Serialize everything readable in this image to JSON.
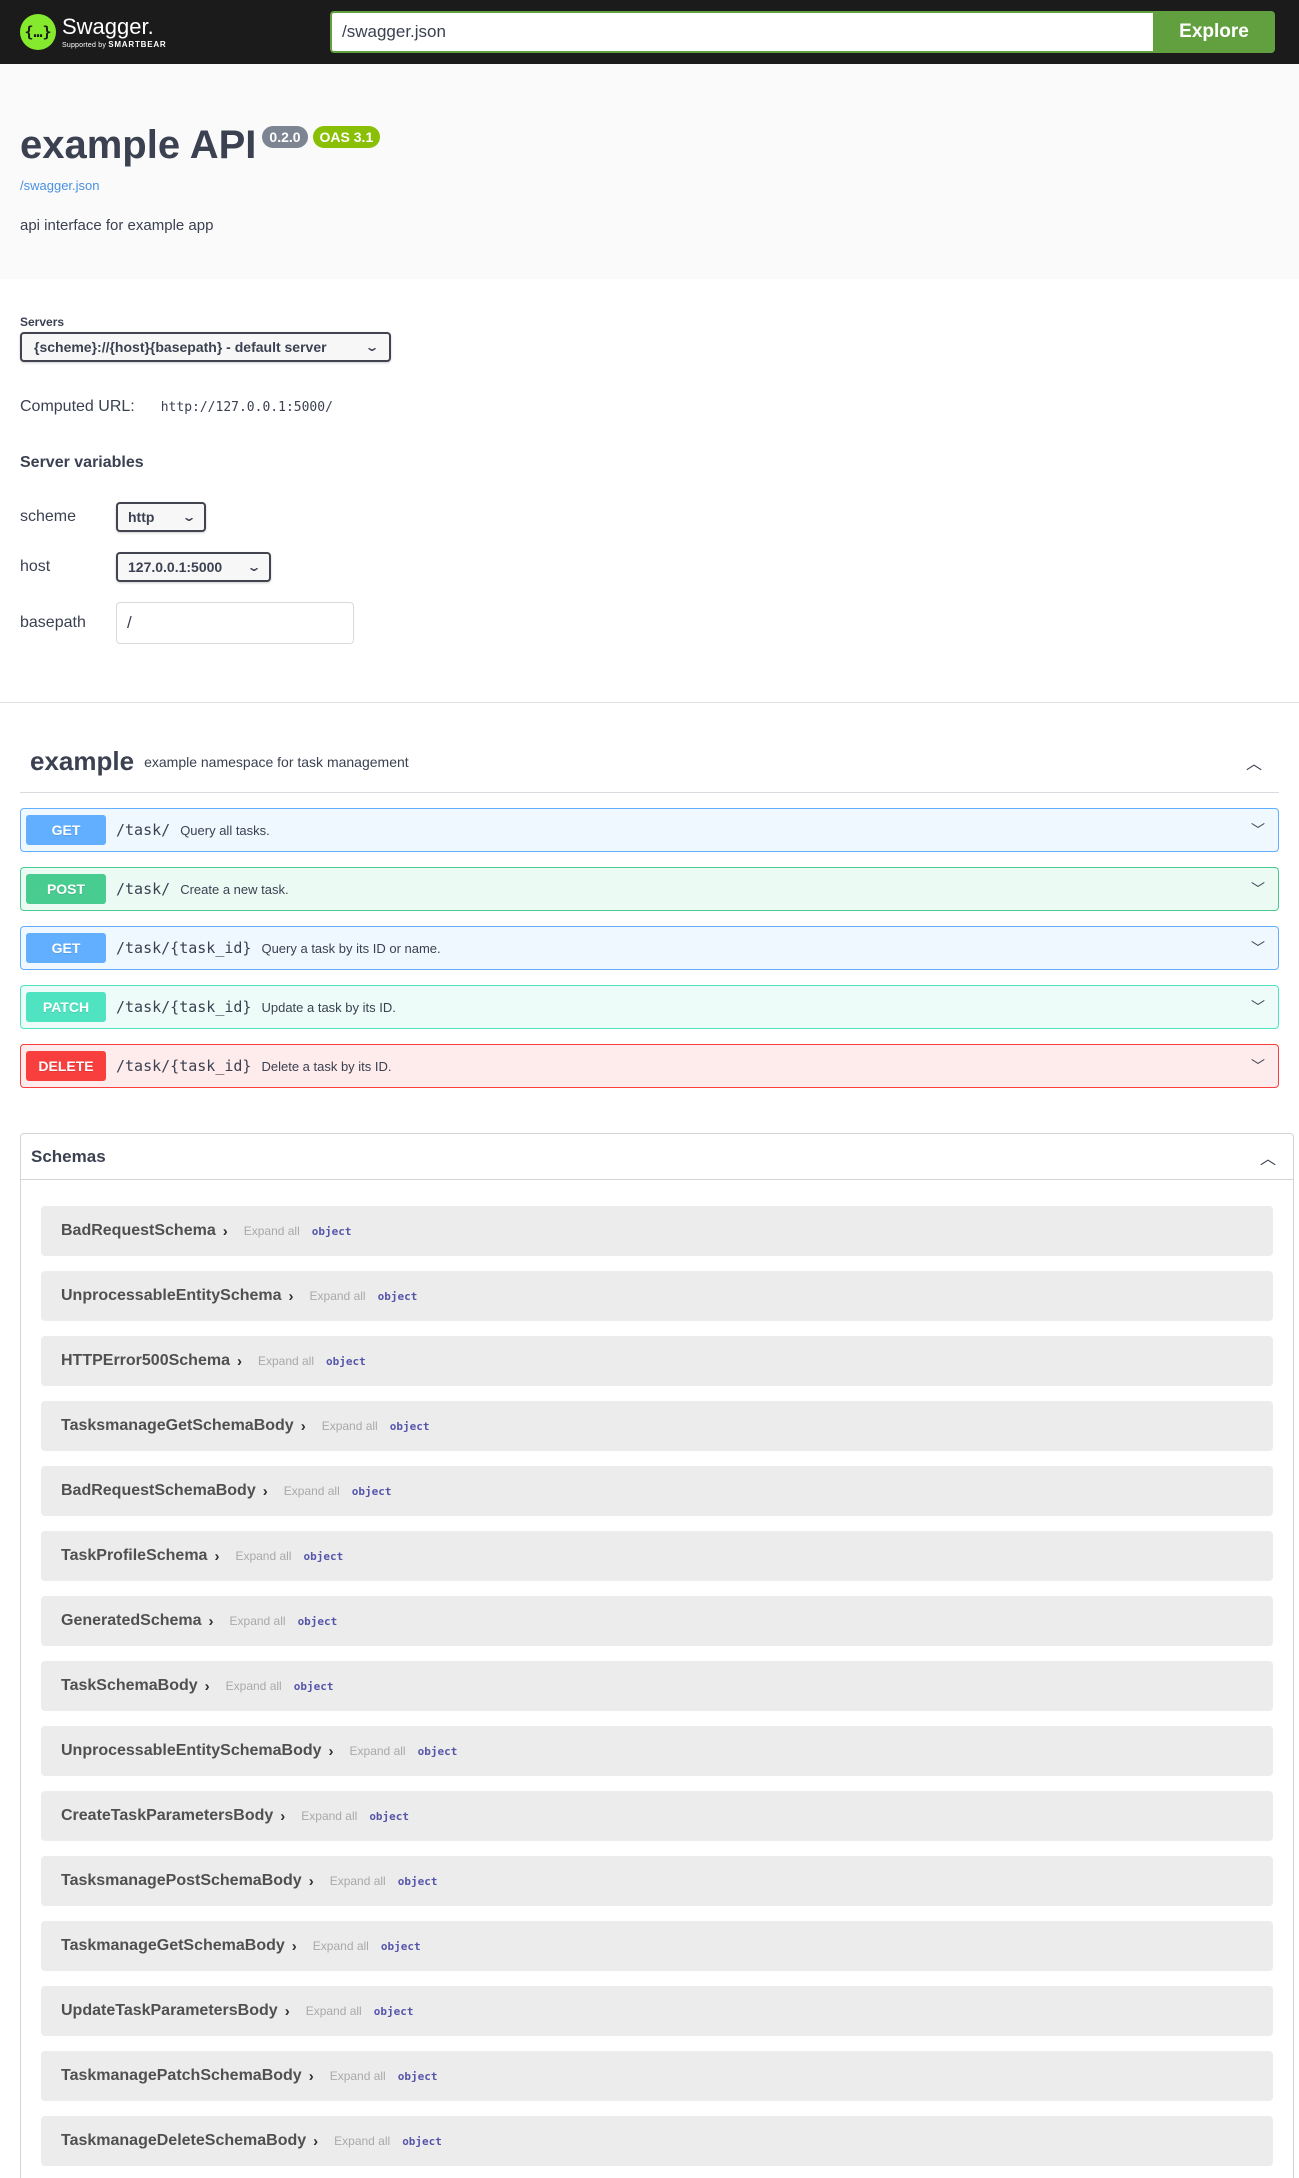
{
  "topbar": {
    "logo_glyph": "{…}",
    "brand_name": "Swagger.",
    "brand_sub_prefix": "Supported by",
    "brand_sub_company": "SMARTBEAR",
    "url_value": "/swagger.json",
    "explore_label": "Explore"
  },
  "info": {
    "title": "example API",
    "version": "0.2.0",
    "oas": "OAS 3.1",
    "spec_link": "/swagger.json",
    "description": "api interface for example app"
  },
  "servers": {
    "label": "Servers",
    "selected": "{scheme}://{host}{basepath} - default server",
    "computed_label": "Computed URL:",
    "computed_url": "http://127.0.0.1:5000/",
    "variables_title": "Server variables",
    "variables": [
      {
        "name": "scheme",
        "value": "http"
      },
      {
        "name": "host",
        "value": "127.0.0.1:5000"
      },
      {
        "name": "basepath",
        "value": "/"
      }
    ]
  },
  "tag": {
    "name": "example",
    "description": "example namespace for task management"
  },
  "operations": [
    {
      "method": "GET",
      "path": "/task/",
      "summary": "Query all tasks."
    },
    {
      "method": "POST",
      "path": "/task/",
      "summary": "Create a new task."
    },
    {
      "method": "GET",
      "path": "/task/{task_id}",
      "summary": "Query a task by its ID or name."
    },
    {
      "method": "PATCH",
      "path": "/task/{task_id}",
      "summary": "Update a task by its ID."
    },
    {
      "method": "DELETE",
      "path": "/task/{task_id}",
      "summary": "Delete a task by its ID."
    }
  ],
  "schemas": {
    "title": "Schemas",
    "expand_label": "Expand all",
    "type_label": "object",
    "items": [
      "BadRequestSchema",
      "UnprocessableEntitySchema",
      "HTTPError500Schema",
      "TasksmanageGetSchemaBody",
      "BadRequestSchemaBody",
      "TaskProfileSchema",
      "GeneratedSchema",
      "TaskSchemaBody",
      "UnprocessableEntitySchemaBody",
      "CreateTaskParametersBody",
      "TasksmanagePostSchemaBody",
      "TaskmanageGetSchemaBody",
      "UpdateTaskParametersBody",
      "TaskmanagePatchSchemaBody",
      "TaskmanageDeleteSchemaBody"
    ]
  },
  "icons": {
    "chevron_down": "chevron-down-icon",
    "chevron_up": "chevron-up-icon",
    "chevron_right": "chevron-right-icon"
  },
  "colors": {
    "get": "#61affe",
    "post": "#49cc90",
    "patch": "#50e3c2",
    "delete": "#f93e3e",
    "accent": "#62a03f"
  }
}
